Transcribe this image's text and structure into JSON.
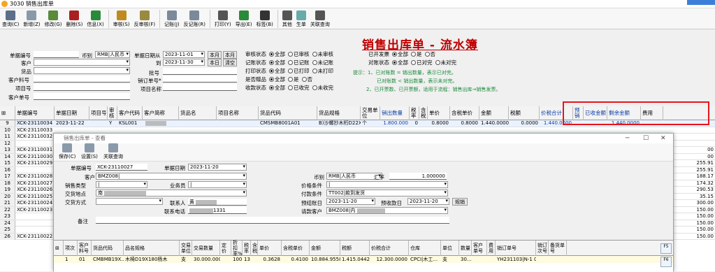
{
  "window": {
    "title": "3030 销售出库单"
  },
  "toolbar": [
    {
      "label": "查询(C)",
      "icon": "query-icon",
      "color": "#5b6f8a"
    },
    {
      "label": "新增(Z)",
      "icon": "new-doc-icon",
      "color": "#8899aa"
    },
    {
      "label": "修改(G)",
      "icon": "edit-icon",
      "color": "#5a8a3a"
    },
    {
      "label": "删除(S)",
      "icon": "delete-icon",
      "color": "#aa2020"
    },
    {
      "label": "信息(X)",
      "icon": "message-icon",
      "color": "#2a8a3a"
    },
    {
      "label": "审核(S)",
      "icon": "approve-icon",
      "color": "#c08a20"
    },
    {
      "label": "反审核(F)",
      "icon": "unapprove-icon",
      "color": "#9a8a40"
    },
    {
      "label": "记账(J)",
      "icon": "post-icon",
      "color": "#7a8a9a"
    },
    {
      "label": "反记账(R)",
      "icon": "unpost-icon",
      "color": "#7a8a9a"
    },
    {
      "label": "打印(Y)",
      "icon": "print-icon",
      "color": "#555"
    },
    {
      "label": "导出(E)",
      "icon": "export-icon",
      "color": "#2a8a3a"
    },
    {
      "label": "标签(B)",
      "icon": "label-icon",
      "color": "#333"
    },
    {
      "label": "其他",
      "icon": "other-icon",
      "color": "#555"
    },
    {
      "label": "生单",
      "icon": "generate-icon",
      "color": "#6aa"
    },
    {
      "label": "关联查询",
      "icon": "link-icon",
      "color": "#555"
    }
  ],
  "page_title": "销售出库单 - 流水簿",
  "filters": {
    "doc_no_label": "单据编号",
    "currency_label": "币别",
    "currency_value": "RMB|人民币",
    "date_from_label": "单据日期从",
    "date_from": "2023-11-01",
    "date_to_label": "到",
    "date_to": "2023-11-30",
    "this_month": "本月",
    "this_month2": "本月",
    "this_day": "本日",
    "clear": "清空",
    "customer_label": "客户",
    "goods_label": "货品",
    "cust_item_label": "客户料号",
    "item_no_label": "项目号",
    "customer_no_label": "客户单号",
    "batch_label": "批号",
    "sales_order_label": "销订单号*",
    "project_name_label": "项目名称"
  },
  "status_filters": [
    {
      "label": "审核状态",
      "opts": [
        "全部",
        "已审核",
        "未审核"
      ],
      "sel": 0
    },
    {
      "label": "记账状态",
      "opts": [
        "全部",
        "已记账",
        "未记账"
      ],
      "sel": 0
    },
    {
      "label": "打印状态",
      "opts": [
        "全部",
        "已打印",
        "未打印"
      ],
      "sel": 0
    },
    {
      "label": "是否赠品",
      "opts": [
        "全部",
        "是",
        "否"
      ],
      "sel": 0
    },
    {
      "label": "收款状态",
      "opts": [
        "全部",
        "已收完",
        "未收完"
      ],
      "sel": 0
    }
  ],
  "invoice_filters": [
    {
      "label": "已开发票",
      "opts": [
        "全部",
        "是",
        "否"
      ],
      "sel": 0
    },
    {
      "label": "对账状态",
      "opts": [
        "全部",
        "已对完",
        "未对完"
      ],
      "sel": 0
    }
  ],
  "tips": [
    "提示：1、已对账数 = 销出数量，表示已对完。",
    "已对账数 < 销出数量，表示未对完。",
    "2、已开票数、已开票额，适用于流程：销售出库→销售发票。"
  ],
  "grid": {
    "headers": [
      "单据编号",
      "单据日期",
      "项目号",
      "审核",
      "客户代码",
      "客户简称",
      "货品名",
      "项目名称",
      "货品代码",
      "货品规格",
      "交易单位",
      "销出数量",
      "税率",
      "含税",
      "单价",
      "含税单价",
      "金额",
      "税额",
      "价税合计",
      "预销",
      "已收金额",
      "剩余金额",
      "费用"
    ],
    "rows": [
      {
        "n": "9",
        "no": "XCK-23110034",
        "date": "2023-11-22",
        "audit": "Y",
        "cust": "KSL001",
        "code": "CMSMB8001A01",
        "spec": "B)沙螺抄木桁D22X300杨木",
        "unit": "个",
        "qty": "1.800.000",
        "tax": "0",
        "price": "0.8000",
        "tprice": "0.8000",
        "amt": "1.440.0000",
        "taxamt": "0.0000",
        "total": "1.440.0000",
        "remain": "1.440.0000",
        "fee": ""
      },
      {
        "n": "10",
        "no": "XCK-23110033",
        "fee": ""
      },
      {
        "n": "11",
        "no": "XCK-23110032",
        "fee": ""
      },
      {
        "n": "12",
        "no": "",
        "fee": ""
      },
      {
        "n": "13",
        "no": "XCK-23110031",
        "fee": "00"
      },
      {
        "n": "14",
        "no": "XCK-23110030",
        "fee": "00"
      },
      {
        "n": "15",
        "no": "XCK-23110029",
        "fee": "255.91"
      },
      {
        "n": "16",
        "no": "",
        "fee": "255.91"
      },
      {
        "n": "17",
        "no": "XCK-23110028",
        "fee": "188.17"
      },
      {
        "n": "18",
        "no": "XCK-23110027",
        "fee": "174.32"
      },
      {
        "n": "19",
        "no": "XCK-23110026",
        "fee": "290.53"
      },
      {
        "n": "20",
        "no": "XCK-23110025",
        "fee": "35.15"
      },
      {
        "n": "21",
        "no": "XCK-23110024",
        "fee": "300.00"
      },
      {
        "n": "22",
        "no": "XCK-23110023",
        "fee": "150.00"
      },
      {
        "n": "23",
        "no": "",
        "fee": "150.00"
      },
      {
        "n": "24",
        "no": "",
        "fee": "150.00"
      },
      {
        "n": "25",
        "no": "",
        "fee": "150.00"
      },
      {
        "n": "26",
        "no": "XCK-23110022",
        "fee": "150.00"
      }
    ]
  },
  "dialog": {
    "title": "销售出库单 - 查看",
    "tools": [
      {
        "label": "保存(C)",
        "icon": "save-icon"
      },
      {
        "label": "设置(S)",
        "icon": "settings-icon"
      },
      {
        "label": "关联查询",
        "icon": "link-icon"
      }
    ],
    "doc_no_label": "单据编号",
    "doc_no": "XCK-23110027",
    "doc_date_label": "单据日期",
    "doc_date": "2023-11-20",
    "customer_label": "客户",
    "customer": "BMZ008|",
    "currency_label": "币别",
    "currency": "RMB|人民币",
    "rate_label": "汇率",
    "rate": "1.000000",
    "sales_type_label": "销售类型",
    "sales_type": "|",
    "salesman_label": "业务员",
    "salesman": "|",
    "price_cond_label": "价格条件",
    "price_cond": "|",
    "trade_place_label": "交货地点",
    "trade_place": "南",
    "pay_cond_label": "付款条件",
    "pay_cond": "TT002|款到发货",
    "delivery_label": "交货方式",
    "delivery": "",
    "contact_label": "联系人",
    "contact": "黄",
    "pay_date_label": "预结账日",
    "pay_date": "2023-11-20",
    "settle_date_label": "预收款日",
    "settle_date": "2023-11-20",
    "settle_btn": "规销",
    "phone_label": "联系电话",
    "phone": "1331",
    "settle_cust_label": "请款客户",
    "settle_cust": "BMZ008|内",
    "memo_label": "备注",
    "grid_headers": [
      "项次",
      "客户料号",
      "货品代码",
      "品名规格",
      "交易单位",
      "交易数量",
      "定价",
      "折扣率%",
      "税率",
      "含税",
      "单价",
      "含税单价",
      "金额",
      "税额",
      "价税合计",
      "仓库",
      "单位",
      "数量",
      "客户单号",
      "费用",
      "销订单号",
      "销订次号",
      "备货单号"
    ],
    "row": {
      "idx": "1",
      "item": "01",
      "code": "CMBMB19X...",
      "spec": "木椅D19X180杨木",
      "unit": "支",
      "qty": "30.000.000",
      "disc": "100",
      "tax": "13",
      "price": "0.3628",
      "tprice": "0.4100",
      "amt": "10.884.9558",
      "taxamt": "1.415.0442",
      "total": "12.300.0000",
      "wh": "CPCI|木工...",
      "wunit": "支",
      "wqty": "30....",
      "order": "YH231103|N-1 01"
    },
    "side_btns": [
      "F5",
      "F6"
    ]
  }
}
